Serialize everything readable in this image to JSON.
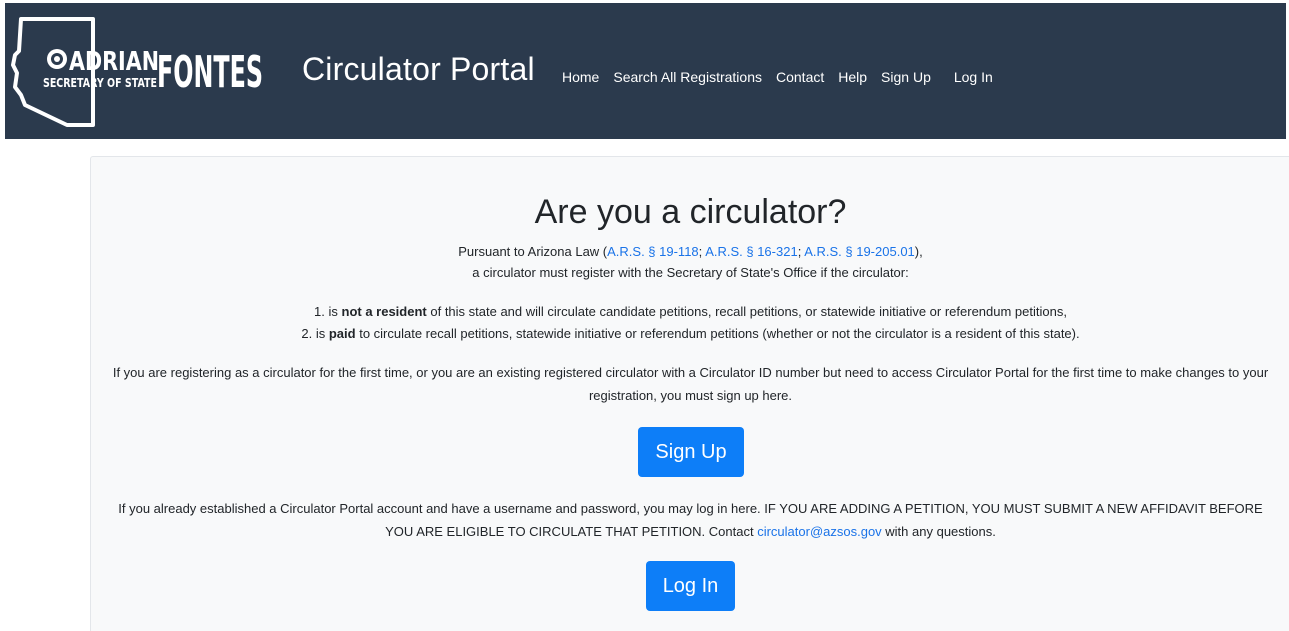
{
  "header": {
    "logo_text": "ADRIANFONTES SECRETARY OF STATE",
    "brand": "Circulator Portal",
    "nav": [
      "Home",
      "Search All Registrations",
      "Contact",
      "Help",
      "Sign Up",
      "Log In"
    ]
  },
  "main": {
    "title": "Are you a circulator?",
    "intro_prefix": "Pursuant to Arizona Law (",
    "law_links": [
      "A.R.S. § 19-118",
      "A.R.S. § 16-321",
      "A.R.S. § 19-205.01"
    ],
    "law_sep": "; ",
    "intro_suffix": "),",
    "intro_line2": "a circulator must register with the Secretary of State's Office if the circulator:",
    "item1_pre": "1. is ",
    "item1_bold": "not a resident",
    "item1_post": " of this state and will circulate candidate petitions, recall petitions, or statewide initiative or referendum petitions,",
    "item2_pre": "2. is ",
    "item2_bold": "paid",
    "item2_post": " to circulate recall petitions, statewide initiative or referendum petitions (whether or not the circulator is a resident of this state).",
    "signup_para": "If you are registering as a circulator for the first time, or you are an existing registered circulator with a Circulator ID number but need to access Circulator Portal for the first time to make changes to your registration, you must sign up here.",
    "signup_button": "Sign Up",
    "login_para_pre": "If you already established a Circulator Portal account and have a username and password, you may log in here. IF YOU ARE ADDING A PETITION, YOU MUST SUBMIT A NEW AFFIDAVIT BEFORE YOU ARE ELIGIBLE TO CIRCULATE THAT PETITION. Contact ",
    "contact_email": "circulator@azsos.gov",
    "login_para_post": " with any questions.",
    "login_button": "Log In"
  },
  "colors": {
    "navbar": "#2b3a4d",
    "link": "#1a73e8",
    "button": "#0d7ef8",
    "panel": "#f8f9fa"
  }
}
